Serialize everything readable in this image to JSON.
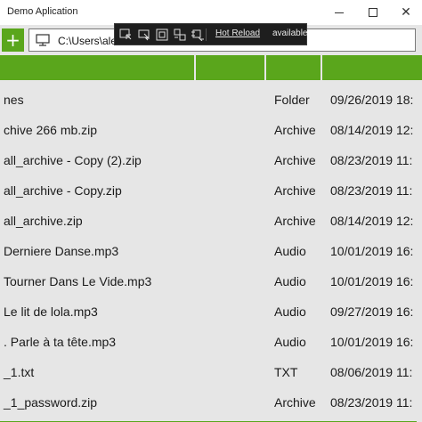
{
  "window": {
    "title": "Demo Aplication"
  },
  "toolbar": {
    "add_label": "+",
    "path": "C:\\Users\\alex"
  },
  "debug_toolbar": {
    "hot_reload_link": "Hot Reload",
    "hot_reload_status": "available"
  },
  "table": {
    "rows": [
      {
        "name": "nes",
        "type": "Folder",
        "date": "09/26/2019 18:"
      },
      {
        "name": "chive 266 mb.zip",
        "type": "Archive",
        "date": "08/14/2019 12:"
      },
      {
        "name": "all_archive - Copy (2).zip",
        "type": "Archive",
        "date": "08/23/2019 11:"
      },
      {
        "name": "all_archive - Copy.zip",
        "type": "Archive",
        "date": "08/23/2019 11:"
      },
      {
        "name": "all_archive.zip",
        "type": "Archive",
        "date": "08/14/2019 12:"
      },
      {
        "name": "Derniere Danse.mp3",
        "type": "Audio",
        "date": "10/01/2019 16:"
      },
      {
        "name": "Tourner Dans Le Vide.mp3",
        "type": "Audio",
        "date": "10/01/2019 16:"
      },
      {
        "name": "Le lit de lola.mp3",
        "type": "Audio",
        "date": "09/27/2019 16:"
      },
      {
        "name": ". Parle à ta tête.mp3",
        "type": "Audio",
        "date": "10/01/2019 16:"
      },
      {
        "name": "_1.txt",
        "type": "TXT",
        "date": "08/06/2019 11:"
      },
      {
        "name": "_1_password.zip",
        "type": "Archive",
        "date": "08/23/2019 11:"
      }
    ]
  },
  "colors": {
    "accent": "#5aa61c",
    "background": "#e6e6e6",
    "debug_bg": "#1e1e1e"
  }
}
